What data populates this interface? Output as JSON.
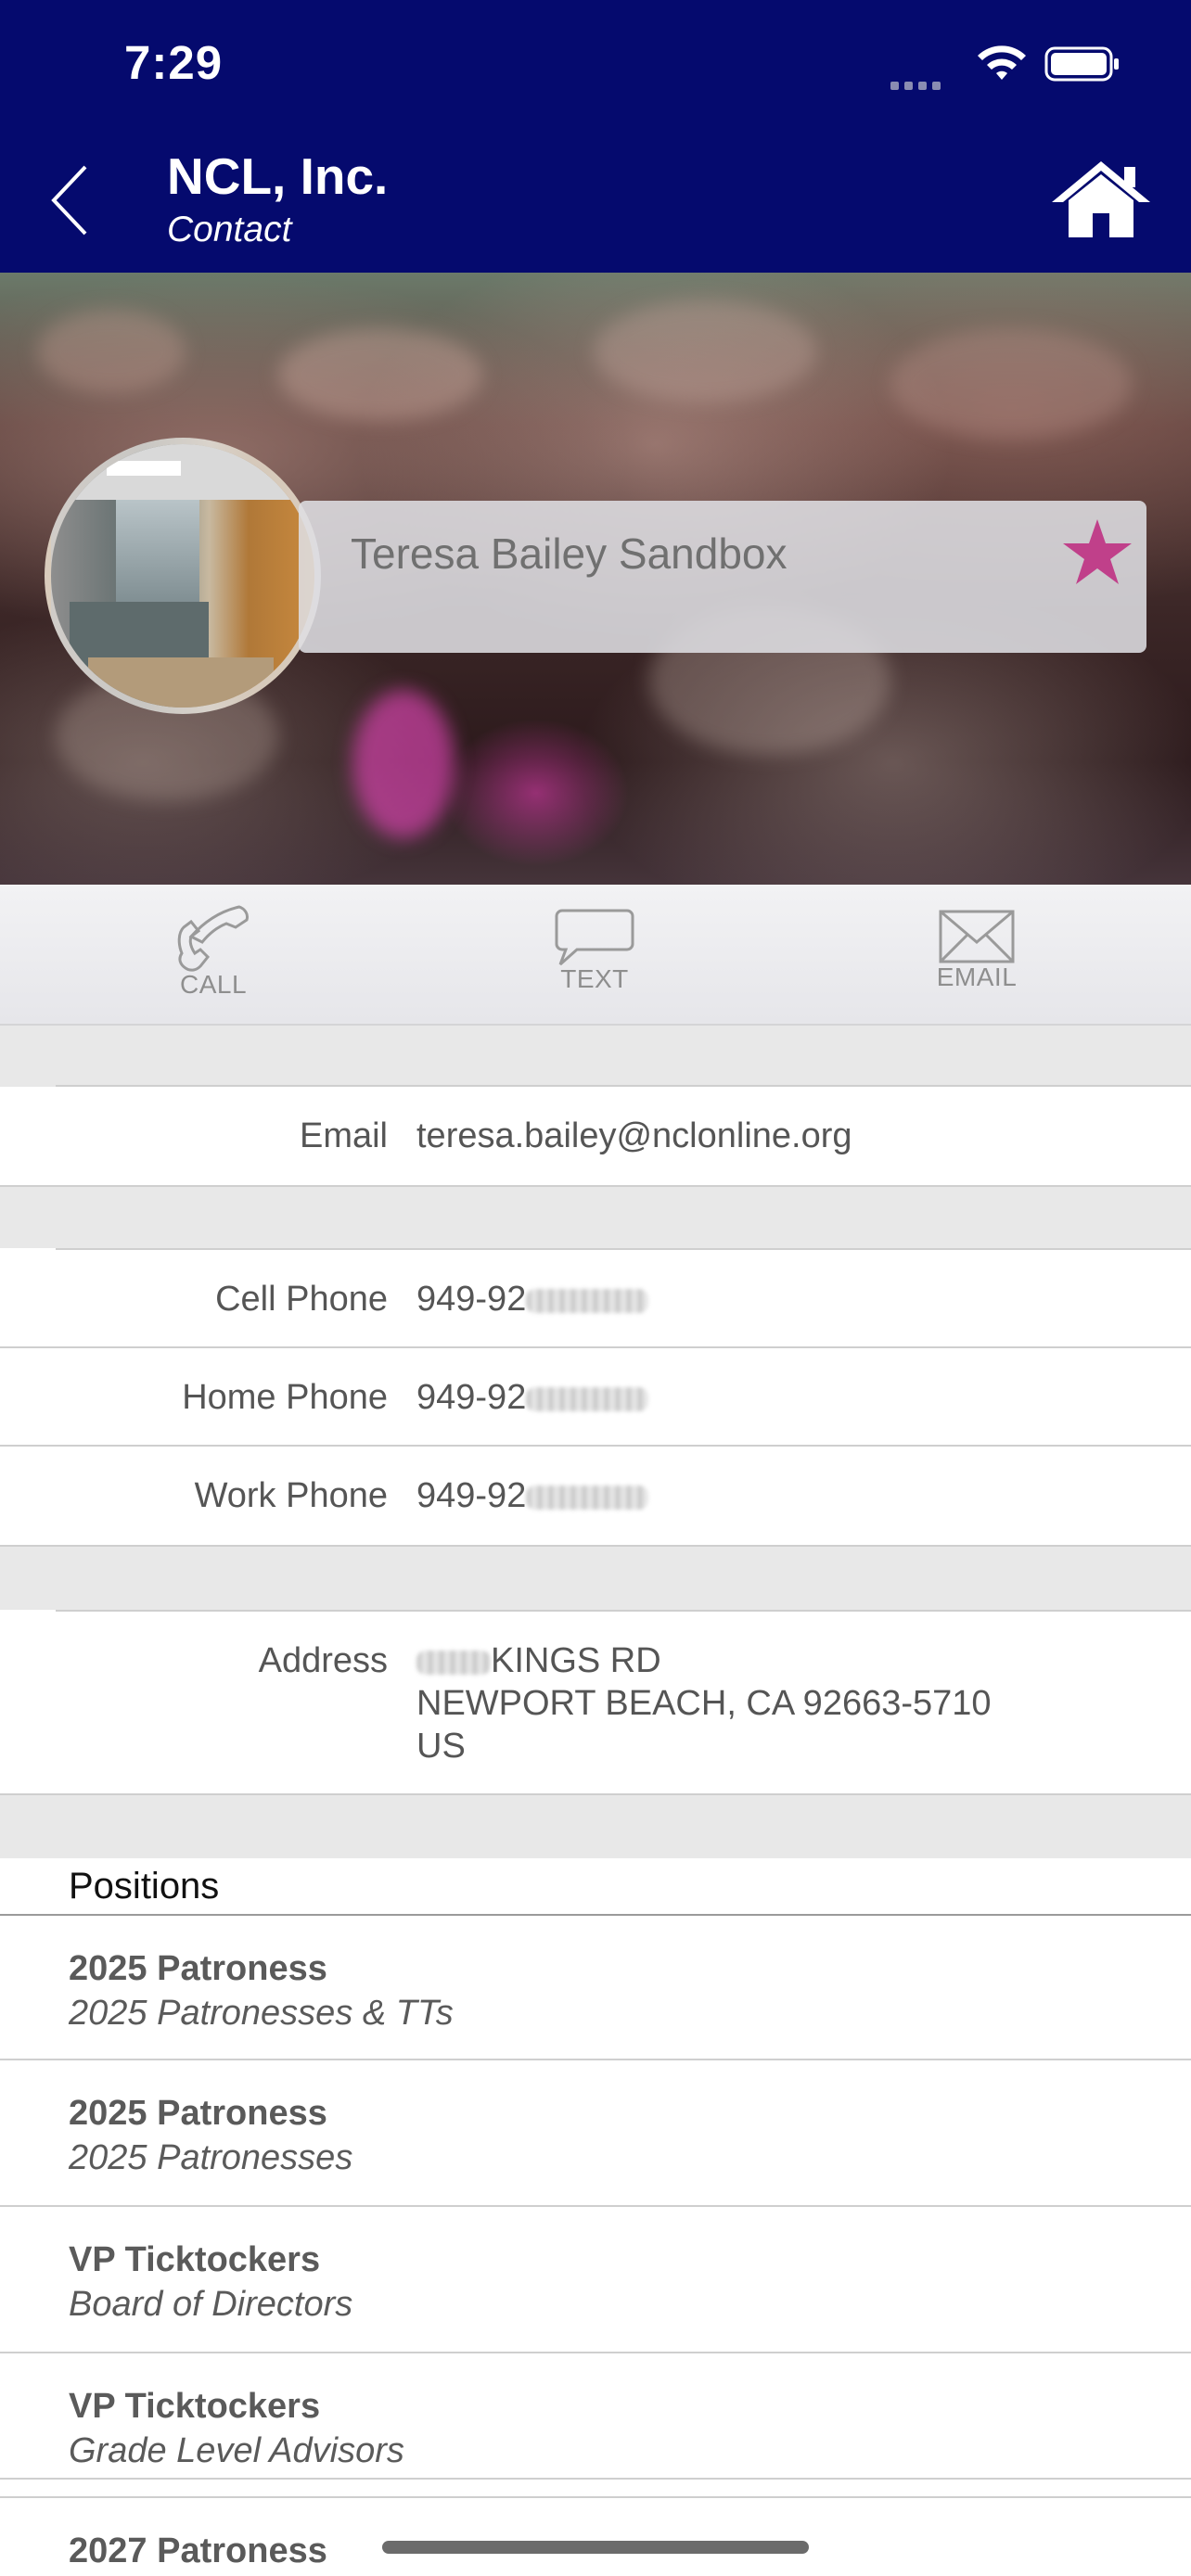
{
  "status_bar": {
    "time": "7:29"
  },
  "nav": {
    "title": "NCL, Inc.",
    "subtitle": "Contact"
  },
  "contact": {
    "name": "Teresa Bailey Sandbox",
    "favorite": true,
    "favorite_color": "#c0408a"
  },
  "actions": [
    {
      "label": "CALL",
      "icon": "phone-icon"
    },
    {
      "label": "TEXT",
      "icon": "speech-bubble-icon"
    },
    {
      "label": "EMAIL",
      "icon": "envelope-icon"
    }
  ],
  "fields": {
    "email": {
      "label": "Email",
      "value": "teresa.bailey@nclonline.org"
    },
    "cell_phone": {
      "label": "Cell Phone",
      "value": "949-92"
    },
    "home_phone": {
      "label": "Home Phone",
      "value": "949-92"
    },
    "work_phone": {
      "label": "Work Phone",
      "value": "949-92"
    },
    "address": {
      "label": "Address",
      "line1": "KINGS RD",
      "line2": "NEWPORT BEACH, CA 92663-5710",
      "line3": "US"
    }
  },
  "positions": {
    "header": "Positions",
    "items": [
      {
        "title": "2025 Patroness",
        "group": "2025 Patronesses & TTs"
      },
      {
        "title": "2025 Patroness",
        "group": "2025 Patronesses"
      },
      {
        "title": "VP Ticktockers",
        "group": "Board of Directors"
      },
      {
        "title": "VP Ticktockers",
        "group": "Grade Level Advisors"
      },
      {
        "title": "2027 Patroness",
        "group": ""
      }
    ]
  },
  "colors": {
    "header_bg": "#050a6e",
    "section_gap": "#e8e8e8"
  }
}
